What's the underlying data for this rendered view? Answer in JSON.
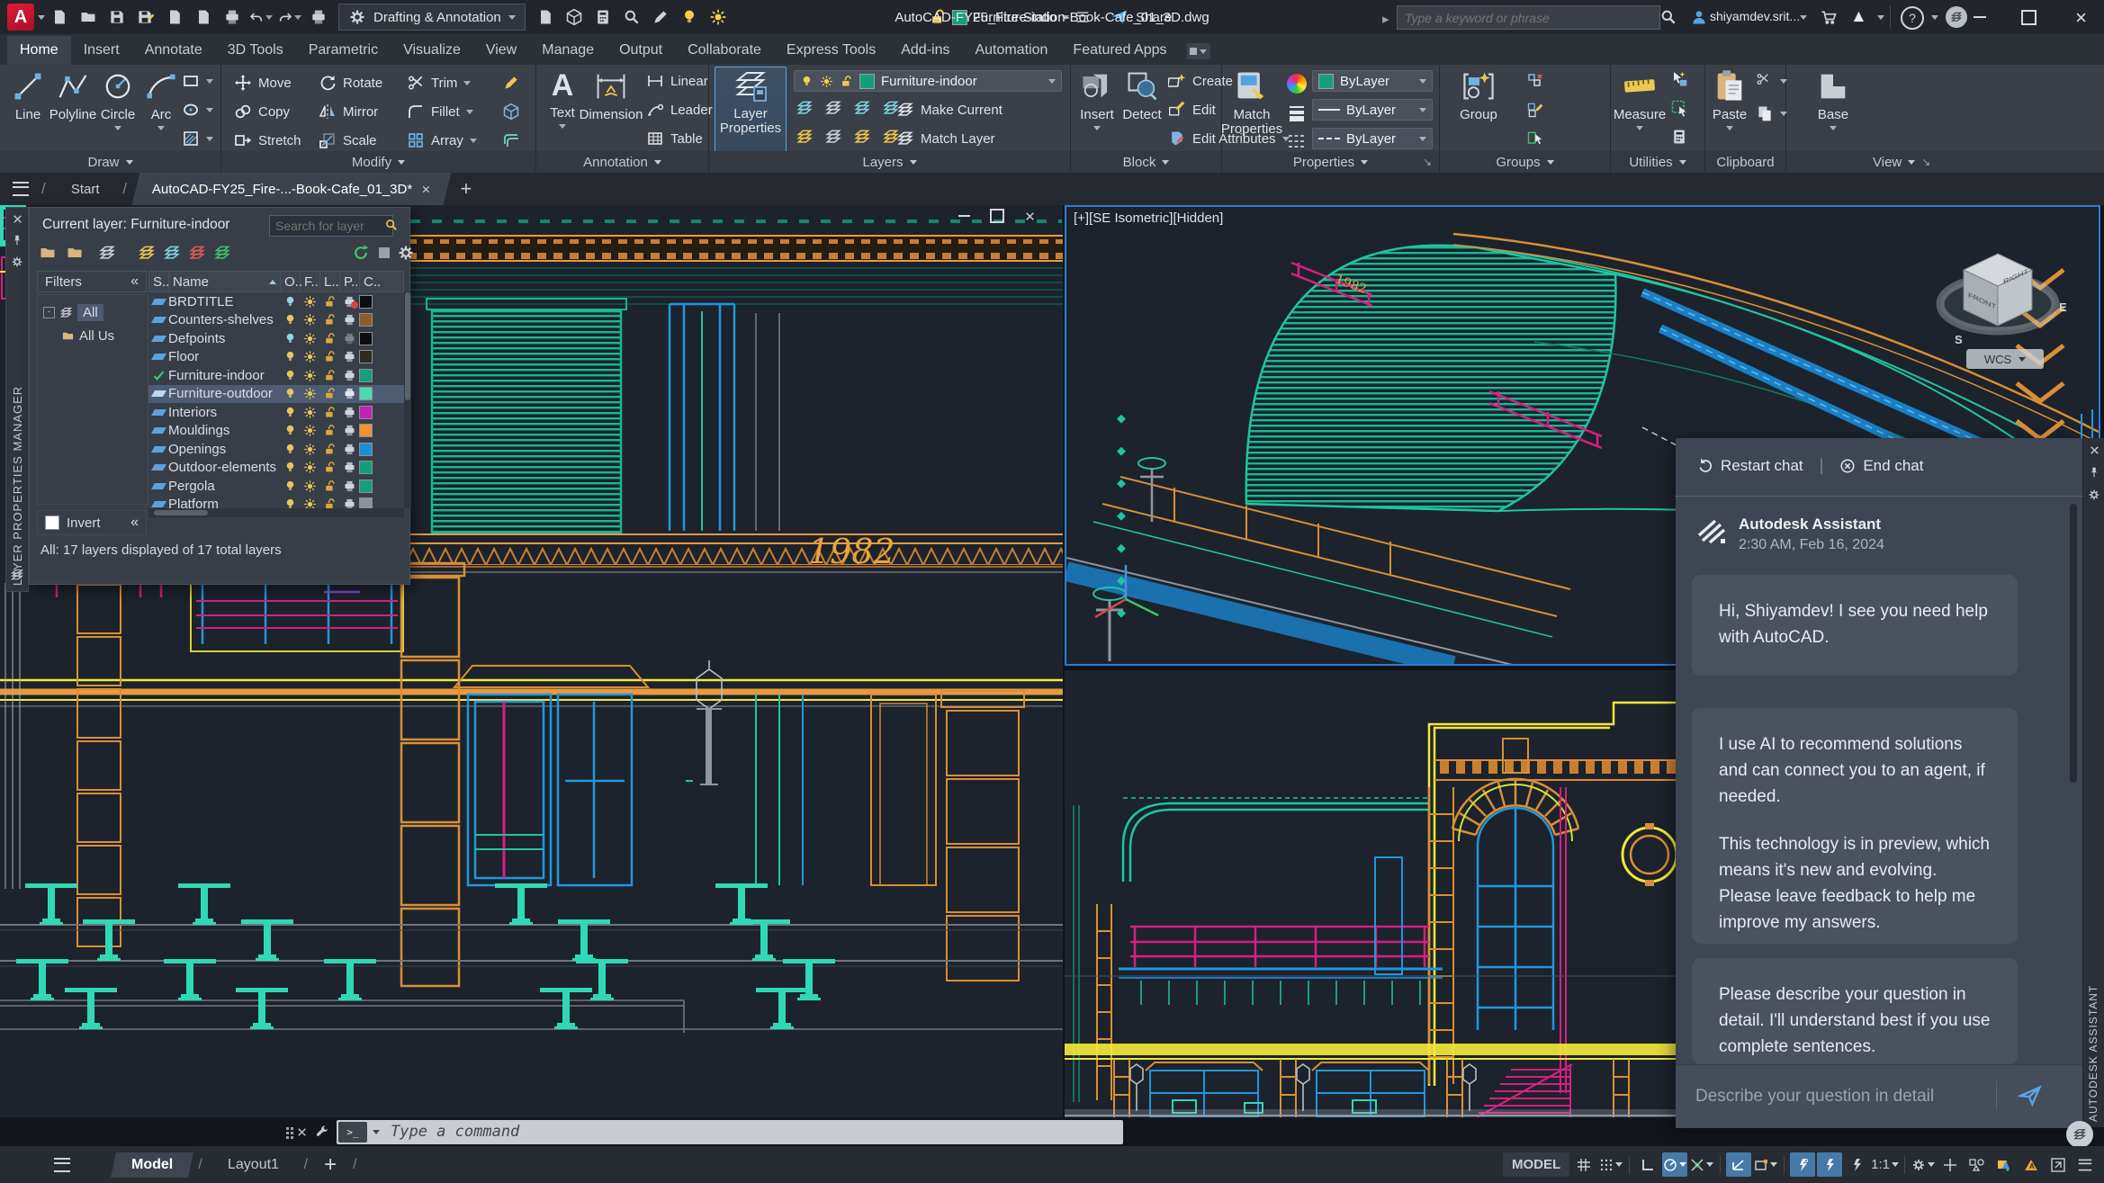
{
  "titlebar": {
    "workspace": "Drafting & Annotation",
    "quick_layer": "Furniture-indo",
    "share_label": "Share",
    "doc_title": "AutoCAD-FY25_Fire-Station-Book-Cafe_01_3D.dwg",
    "search_placeholder": "Type a keyword or phrase",
    "user_name": "shiyamdev.srit..."
  },
  "ribbon": {
    "tabs": [
      "Home",
      "Insert",
      "Annotate",
      "3D Tools",
      "Parametric",
      "Visualize",
      "View",
      "Manage",
      "Output",
      "Collaborate",
      "Express Tools",
      "Add-ins",
      "Automation",
      "Featured Apps"
    ],
    "draw": {
      "label": "Draw",
      "line": "Line",
      "polyline": "Polyline",
      "circle": "Circle",
      "arc": "Arc"
    },
    "modify": {
      "label": "Modify",
      "move": "Move",
      "rotate": "Rotate",
      "trim": "Trim",
      "copy": "Copy",
      "mirror": "Mirror",
      "fillet": "Fillet",
      "stretch": "Stretch",
      "scale": "Scale",
      "array": "Array"
    },
    "annotation": {
      "label": "Annotation",
      "text": "Text",
      "dimension": "Dimension",
      "linear": "Linear",
      "leader": "Leader",
      "table": "Table"
    },
    "layers": {
      "label": "Layers",
      "layer_properties_1": "Layer",
      "layer_properties_2": "Properties",
      "current_layer": "Furniture-indoor",
      "make_current": "Make Current",
      "match_layer": "Match Layer"
    },
    "block": {
      "label": "Block",
      "insert": "Insert",
      "detect": "Detect",
      "create": "Create",
      "edit": "Edit",
      "edit_attributes": "Edit Attributes"
    },
    "properties": {
      "label": "Properties",
      "match_properties_1": "Match",
      "match_properties_2": "Properties",
      "color": "ByLayer",
      "lineweight": "ByLayer",
      "linetype": "ByLayer"
    },
    "groups": {
      "label": "Groups",
      "group": "Group"
    },
    "utilities": {
      "label": "Utilities",
      "measure": "Measure"
    },
    "clipboard": {
      "label": "Clipboard",
      "paste": "Paste"
    },
    "view": {
      "label": "View",
      "base": "Base"
    }
  },
  "file_tabs": {
    "start": "Start",
    "document": "AutoCAD-FY25_Fire-...-Book-Cafe_01_3D*"
  },
  "layer_palette": {
    "vertical_title": "LAYER PROPERTIES MANAGER",
    "current_layer": "Current layer: Furniture-indoor",
    "search_placeholder": "Search for layer",
    "filters_label": "Filters",
    "tree_all": "All",
    "tree_all_used": "All Us",
    "columns": {
      "status": "S..",
      "name": "Name",
      "on": "O..",
      "freeze": "F..",
      "lock": "L..",
      "plot": "P..",
      "color": "C.."
    },
    "rows": [
      {
        "name": "BRDTITLE",
        "on": "#8fd8e4",
        "color": "#0d0d0d"
      },
      {
        "name": "Counters-shelves",
        "on": "#eac45e",
        "color": "#8a5c2e"
      },
      {
        "name": "Defpoints",
        "on": "#8fd8e4",
        "color": "#0d0d0d"
      },
      {
        "name": "Floor",
        "on": "#eac45e",
        "color": "#2f2a22"
      },
      {
        "name": "Furniture-indoor",
        "on": "#eac45e",
        "color": "#13a079"
      },
      {
        "name": "Furniture-outdoor",
        "on": "#eac45e",
        "color": "#4fd9b1"
      },
      {
        "name": "Interiors",
        "on": "#eac45e",
        "color": "#c81fb4"
      },
      {
        "name": "Mouldings",
        "on": "#eac45e",
        "color": "#f0922e"
      },
      {
        "name": "Openings",
        "on": "#eac45e",
        "color": "#1e8ed8"
      },
      {
        "name": "Outdoor-elements",
        "on": "#eac45e",
        "color": "#13a079"
      },
      {
        "name": "Pergola",
        "on": "#eac45e",
        "color": "#13a079"
      },
      {
        "name": "Platform",
        "on": "#eac45e",
        "color": "#8d9298"
      }
    ],
    "invert_label": "Invert",
    "status_text": "All: 17 layers displayed of 17 total layers"
  },
  "viewport": {
    "iso_label": "[+][SE Isometric][Hidden]",
    "wcs_label": "WCS",
    "year_sign": "1982"
  },
  "chat": {
    "restart_label": "Restart chat",
    "end_label": "End chat",
    "vertical_title": "AUTODESK ASSISTANT",
    "sender": "Autodesk Assistant",
    "timestamp": "2:30 AM, Feb 16, 2024",
    "message_1": "Hi, Shiyamdev! I see you need help with AutoCAD.",
    "message_2a": "I use AI to recommend solutions and can connect you to an agent, if needed.",
    "message_2b": "This technology is in preview, which means it's new and evolving. Please leave feedback to help me improve my answers.",
    "message_3": "Please describe your question in detail. I'll understand best if you use complete sentences.",
    "input_placeholder": "Describe your question in detail"
  },
  "command_line": {
    "placeholder": "Type a command"
  },
  "layout_bar": {
    "model": "Model",
    "layout1": "Layout1"
  },
  "status_bar": {
    "model_label": "MODEL",
    "scale": "1:1"
  },
  "drawing_colors": {
    "teal": "#1fc5a1",
    "orange": "#e89a3c",
    "yellow": "#f1e83a",
    "magenta": "#d61f82",
    "blue": "#2196dd",
    "gray": "#9099a1"
  }
}
